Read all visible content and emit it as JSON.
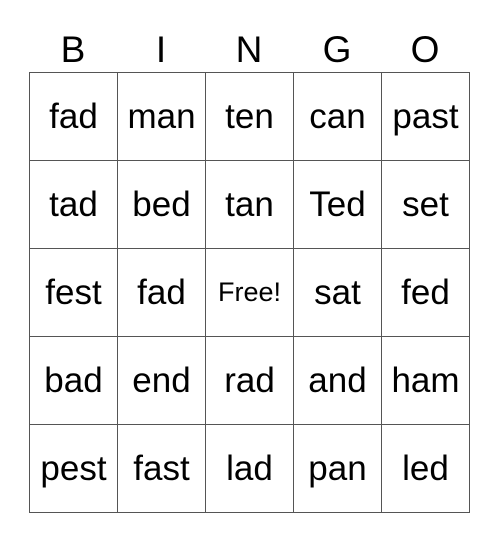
{
  "header": [
    "B",
    "I",
    "N",
    "G",
    "O"
  ],
  "rows": [
    [
      "fad",
      "man",
      "ten",
      "can",
      "past"
    ],
    [
      "tad",
      "bed",
      "tan",
      "Ted",
      "set"
    ],
    [
      "fest",
      "fad",
      "Free!",
      "sat",
      "fed"
    ],
    [
      "bad",
      "end",
      "rad",
      "and",
      "ham"
    ],
    [
      "pest",
      "fast",
      "lad",
      "pan",
      "led"
    ]
  ]
}
